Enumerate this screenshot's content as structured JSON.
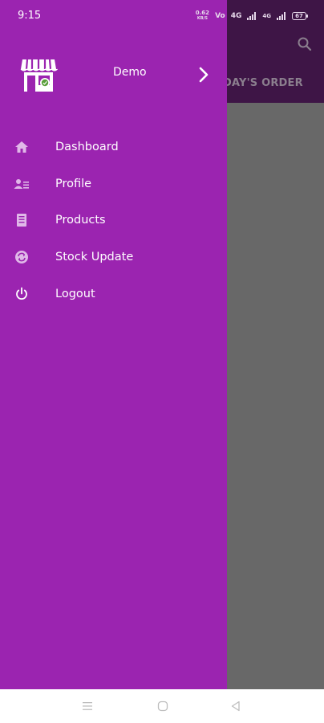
{
  "status_bar": {
    "time": "9:15",
    "net_speed_value": "0.62",
    "net_speed_unit": "KB/S",
    "sim1": "4G",
    "sim2": "4G",
    "battery": "67"
  },
  "background_app": {
    "tab_label": "DAY'S ORDER",
    "search_icon": "search-icon"
  },
  "drawer": {
    "user_name": "Demo",
    "logo_icon": "store-icon",
    "menu": [
      {
        "label": "Dashboard",
        "icon": "home-icon"
      },
      {
        "label": "Profile",
        "icon": "profile-icon"
      },
      {
        "label": "Products",
        "icon": "products-icon"
      },
      {
        "label": "Stock Update",
        "icon": "stock-icon"
      },
      {
        "label": "Logout",
        "icon": "power-icon"
      }
    ]
  },
  "colors": {
    "drawer_bg": "#9b24b0",
    "toolbar_bg": "#3e1546",
    "scrim": "#686868"
  },
  "nav_bar": {
    "buttons": [
      "menu-icon",
      "home-icon",
      "back-icon"
    ]
  }
}
